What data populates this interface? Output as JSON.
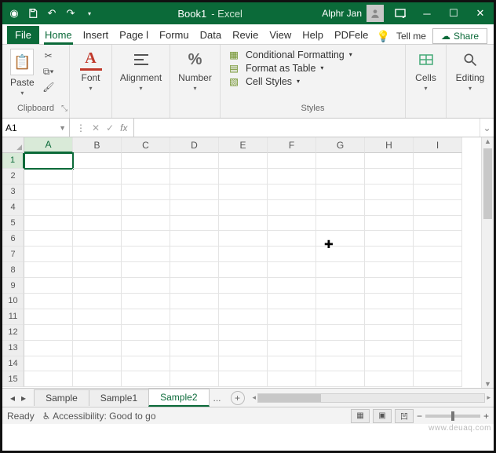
{
  "title": {
    "book": "Book1",
    "sep": " - ",
    "app": "Excel",
    "user": "Alphr Jan"
  },
  "tabs": {
    "file": "File",
    "home": "Home",
    "insert": "Insert",
    "page": "Page l",
    "formulas": "Formu",
    "data": "Data",
    "review": "Revie",
    "view": "View",
    "help": "Help",
    "pdf": "PDFele",
    "tellme": "Tell me"
  },
  "share": "Share",
  "ribbon": {
    "clipboard": {
      "label": "Clipboard",
      "paste": "Paste"
    },
    "font": {
      "label": "Font"
    },
    "alignment": {
      "label": "Alignment"
    },
    "number": {
      "label": "Number"
    },
    "styles": {
      "label": "Styles",
      "conditional": "Conditional Formatting",
      "table": "Format as Table",
      "cell": "Cell Styles"
    },
    "cells": {
      "label": "Cells"
    },
    "editing": {
      "label": "Editing"
    }
  },
  "namebox": "A1",
  "columns": [
    "A",
    "B",
    "C",
    "D",
    "E",
    "F",
    "G",
    "H",
    "I"
  ],
  "rows": [
    "1",
    "2",
    "3",
    "4",
    "5",
    "6",
    "7",
    "8",
    "9",
    "10",
    "11",
    "12",
    "13",
    "14",
    "15"
  ],
  "sheets": {
    "s1": "Sample",
    "s2": "Sample1",
    "s3": "Sample2",
    "more": "..."
  },
  "status": {
    "ready": "Ready",
    "access": "Accessibility: Good to go",
    "zoom": "100%"
  },
  "watermark": "www.deuaq.com"
}
